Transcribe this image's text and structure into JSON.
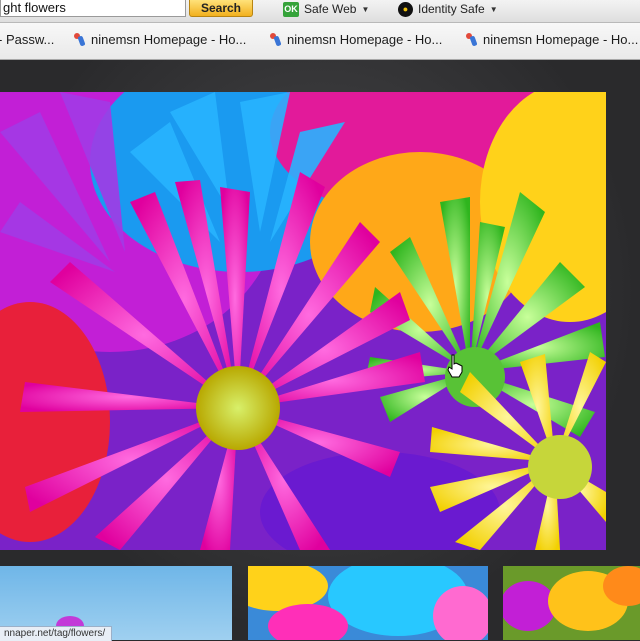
{
  "toolbar": {
    "search_value": "ght flowers",
    "search_button_label": "Search",
    "safe_web_label": "Safe Web",
    "safe_web_icon_text": "OK",
    "identity_safe_label": "Identity Safe"
  },
  "bookmarks": [
    {
      "label": "- Passw..."
    },
    {
      "label": "ninemsn Homepage - Ho..."
    },
    {
      "label": "ninemsn Homepage - Ho..."
    },
    {
      "label": "ninemsn Homepage - Ho..."
    }
  ],
  "status_bar": {
    "url_text": "nnaper.net/tag/flowers/"
  },
  "colors": {
    "search_button": "#f2b01e",
    "safe_web_icon": "#35a33a",
    "flower_magenta": "#ff1fc8",
    "flower_green": "#4fdc2c",
    "flower_yellow": "#ffe81a",
    "flower_blue": "#1aa0f0",
    "flower_orange": "#ffb21e",
    "flower_purple": "#8a2be2"
  },
  "icons": [
    "norton-ok-icon",
    "identity-safe-lock-icon",
    "ninemsn-favicon",
    "hand-cursor-icon"
  ]
}
